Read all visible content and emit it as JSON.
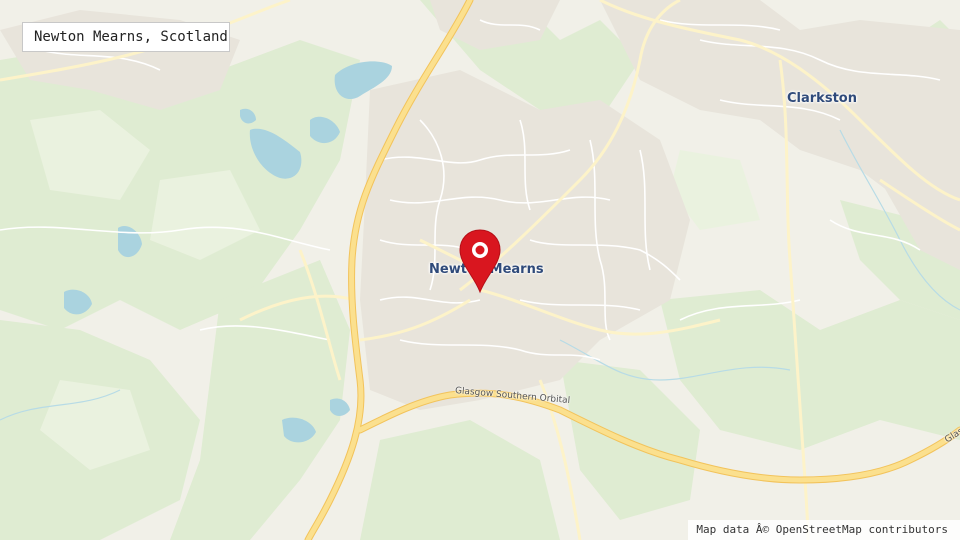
{
  "search": {
    "query": "Newton Mearns, Scotland"
  },
  "places": {
    "newton_mearns": "Newton Mearns",
    "clarkston": "Clarkston"
  },
  "roads": {
    "orbital": "Glasgow Southern Orbital",
    "glasgow_edge": "Glas"
  },
  "attribution": "Map data Â© OpenStreetMap contributors",
  "marker": {
    "icon": "map-pin-icon",
    "color": "#d9161f"
  },
  "colors": {
    "background": "#f1f0e8",
    "woodland": "#dfecd2",
    "water": "#aad3df",
    "urban": "#e9e7e0",
    "motorway": "#f7dc8a"
  }
}
